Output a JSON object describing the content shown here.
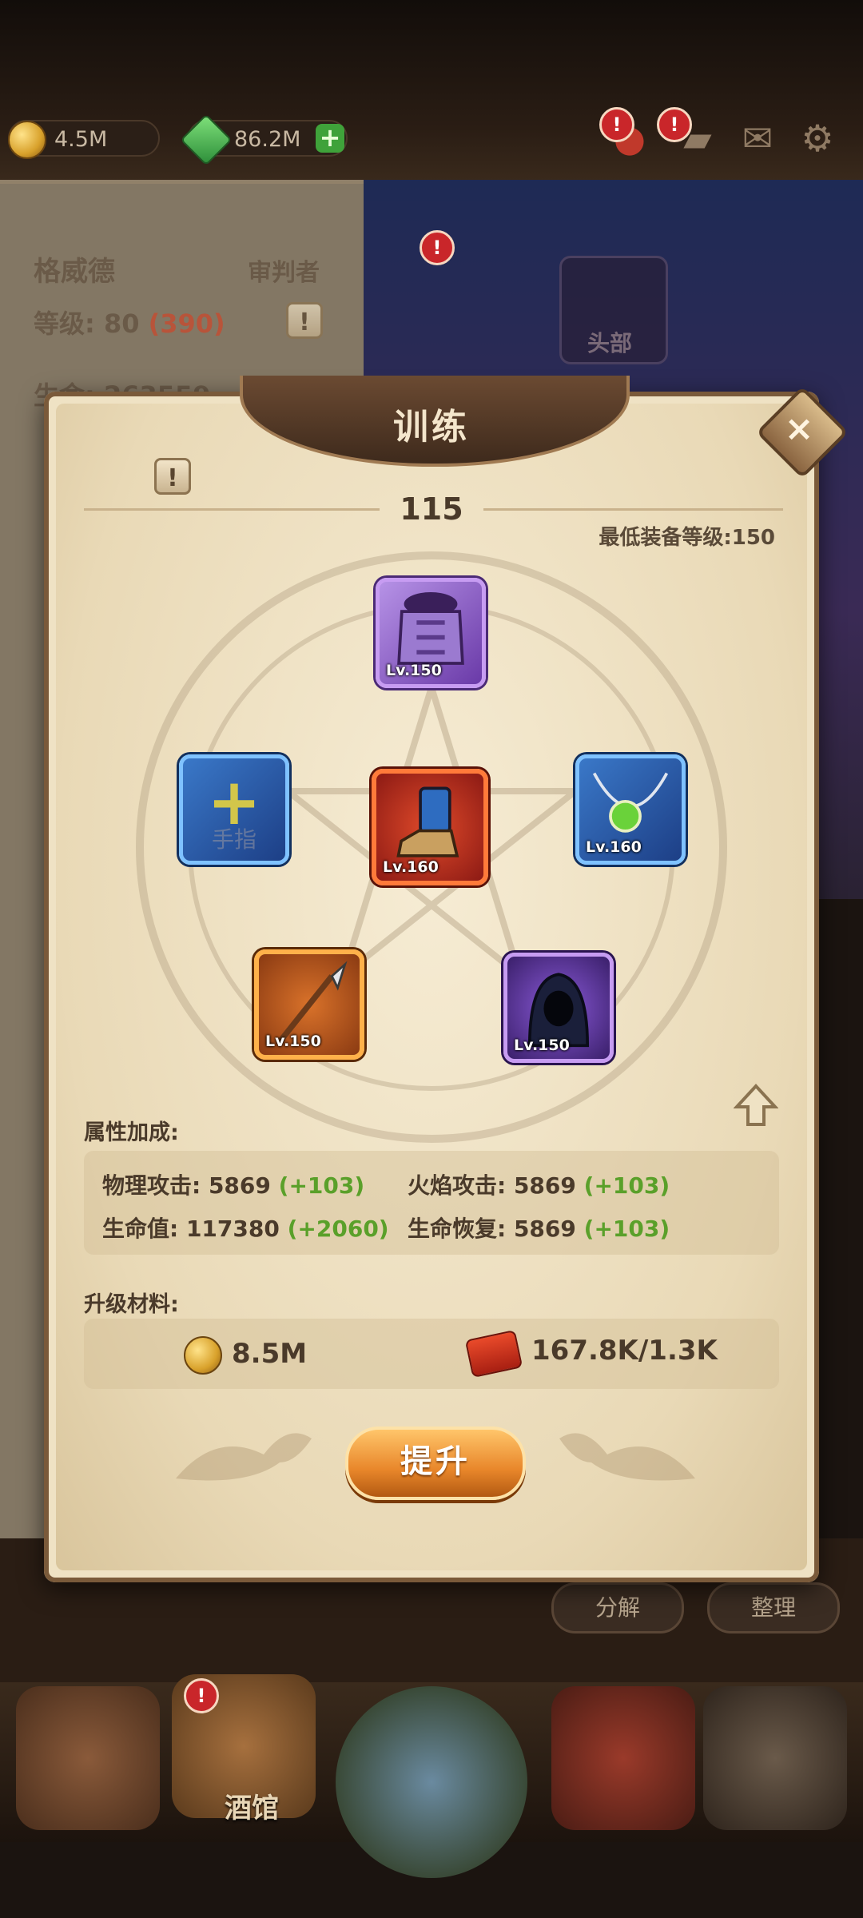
{
  "top_bar": {
    "gold": "4.5M",
    "gems": "86.2M",
    "badge_symbol": "!",
    "icons": [
      "gold-coin-icon",
      "green-gem-icon",
      "plus-icon",
      "potion-icon",
      "chat-icon",
      "mail-icon",
      "settings-gear-icon"
    ]
  },
  "background": {
    "hero_name": "格威德",
    "hero_class": "审判者",
    "level_label": "等级:",
    "level_value": "80",
    "level_extra": "(390)",
    "hp_partial": "生命: 263559",
    "head_slot_label": "头部",
    "decompose_label": "分解",
    "sort_label": "整理"
  },
  "dialog": {
    "title": "训练",
    "info_symbol": "!",
    "close_symbol": "×",
    "training_level": "115",
    "min_equip_level": "最低装备等级:150",
    "slots": {
      "top": {
        "level": "Lv.150",
        "type": "chest-armor",
        "rarity_color": "#8a5ad8"
      },
      "left": {
        "empty": true,
        "label": "手指",
        "symbol": "+"
      },
      "center": {
        "level": "Lv.160",
        "type": "boots",
        "rarity_color": "#d9301a"
      },
      "right": {
        "level": "Lv.160",
        "type": "necklace",
        "rarity_color": "#2a5cb0"
      },
      "bottom_left": {
        "level": "Lv.150",
        "type": "spear",
        "rarity_color": "#d97a2a"
      },
      "bottom_right": {
        "level": "Lv.150",
        "type": "hood",
        "rarity_color": "#6a3aa8"
      }
    },
    "attributes_label": "属性加成:",
    "attributes": [
      {
        "name": "物理攻击:",
        "value": "5869",
        "bonus": "(+103)"
      },
      {
        "name": "火焰攻击:",
        "value": "5869",
        "bonus": "(+103)"
      },
      {
        "name": "生命值:",
        "value": "117380",
        "bonus": "(+2060)"
      },
      {
        "name": "生命恢复:",
        "value": "5869",
        "bonus": "(+103)"
      }
    ],
    "materials_label": "升级材料:",
    "materials": [
      {
        "icon": "gold-coin-icon",
        "amount": "8.5M"
      },
      {
        "icon": "scroll-icon",
        "amount": "167.8K/1.3K"
      }
    ],
    "upgrade_button": "提升"
  },
  "bottom_nav": {
    "items": [
      {
        "icon": "house-icon",
        "label": ""
      },
      {
        "icon": "tavern-mug-icon",
        "label": "酒馆",
        "badge": "!"
      },
      {
        "icon": "portal-icon",
        "label": ""
      },
      {
        "icon": "helmet-icon",
        "label": ""
      },
      {
        "icon": "forge-icon",
        "label": ""
      }
    ]
  }
}
